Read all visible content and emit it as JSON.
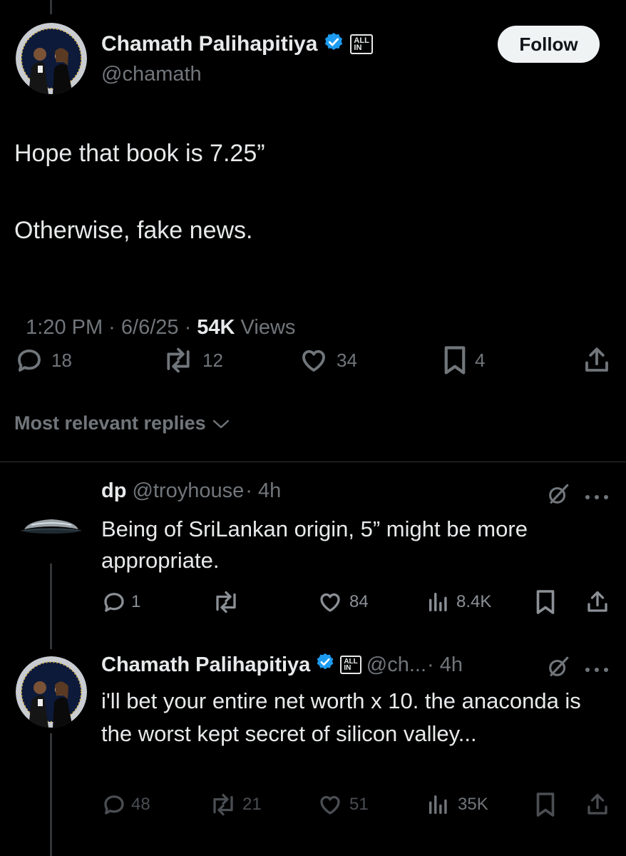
{
  "main_tweet": {
    "author_name": "Chamath Palihapitiya",
    "handle": "@chamath",
    "badge": "ALL IN",
    "follow_label": "Follow",
    "text_line1": "Hope that book is 7.25”",
    "text_line2": "Otherwise, fake news.",
    "meta_time": "1:20 PM · 6/6/25 · ",
    "meta_views_count": "54K",
    "meta_views_label": " Views",
    "stats": {
      "replies": "18",
      "reposts": "12",
      "likes": "34",
      "bookmarks": "4"
    }
  },
  "replies_sort_label": "Most relevant replies",
  "reply1": {
    "author_name": "dp",
    "handle": "@troyhouse",
    "time": "· 4h",
    "text": "Being of SriLankan origin, 5” might be more appropriate.",
    "stats": {
      "replies": "1",
      "reposts": "",
      "likes": "84",
      "views": "8.4K"
    }
  },
  "reply2": {
    "author_name": "Chamath Palihapitiya",
    "badge": "ALL IN",
    "handle": "@ch...",
    "time": "· 4h",
    "text": "i'll bet your entire net worth x 10. the anaconda is the worst kept secret of silicon valley...",
    "stats": {
      "replies": "48",
      "reposts": "21",
      "likes": "51",
      "views": "35K"
    }
  },
  "colors": {
    "background": "#000000",
    "text": "#e7e9ea",
    "muted": "#71767b",
    "verified": "#1d9bf0"
  }
}
